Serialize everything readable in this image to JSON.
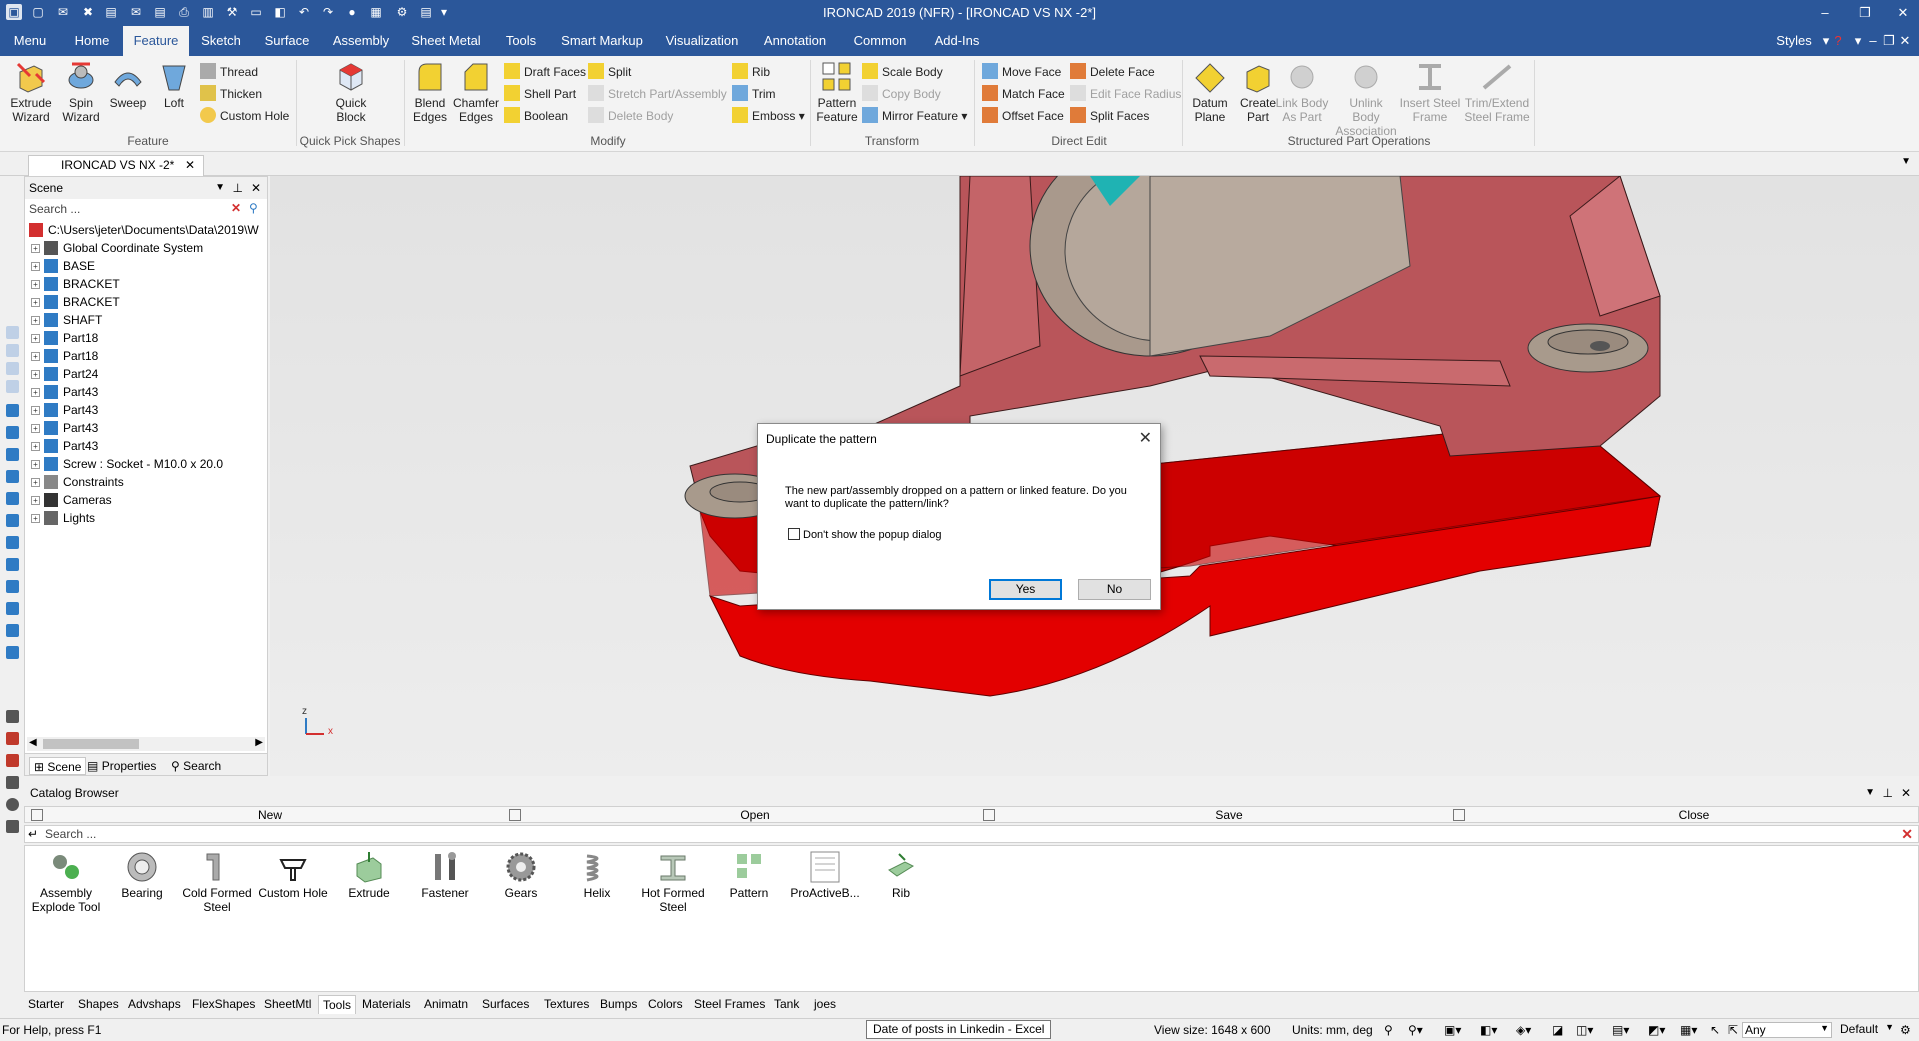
{
  "window": {
    "title": "IRONCAD 2019 (NFR) - [IRONCAD VS NX -2*]",
    "styles_label": "Styles",
    "help_glyph": "?",
    "minimize_glyph": "–",
    "restore_glyph": "❐",
    "close_glyph": "✕"
  },
  "menu_tabs": [
    "Menu",
    "Home",
    "Feature",
    "Sketch",
    "Surface",
    "Assembly",
    "Sheet Metal",
    "Tools",
    "Smart Markup",
    "Visualization",
    "Annotation",
    "Common",
    "Add-Ins"
  ],
  "ribbon": {
    "feature_group": {
      "label": "Feature",
      "extrude": "Extrude Wizard",
      "spin": "Spin Wizard",
      "sweep": "Sweep",
      "loft": "Loft",
      "thread": "Thread",
      "thicken": "Thicken",
      "custom_hole": "Custom Hole"
    },
    "quick_pick": {
      "label": "Quick Pick Shapes",
      "quick_block": "Quick Block"
    },
    "modify_group": {
      "label": "Modify",
      "blend_edges": "Blend Edges",
      "chamfer_edges": "Chamfer Edges",
      "draft_faces": "Draft Faces",
      "shell_part": "Shell Part",
      "boolean": "Boolean",
      "split": "Split",
      "stretch_part": "Stretch Part/Assembly",
      "delete_body": "Delete Body",
      "rib": "Rib",
      "trim": "Trim",
      "emboss": "Emboss"
    },
    "transform_group": {
      "label": "Transform",
      "pattern_feature": "Pattern Feature",
      "scale_body": "Scale Body",
      "copy_body": "Copy Body",
      "mirror_feature": "Mirror Feature"
    },
    "direct_edit_group": {
      "label": "Direct Edit",
      "move_face": "Move Face",
      "match_face": "Match Face",
      "offset_face": "Offset Face",
      "delete_face": "Delete Face",
      "edit_face_radius": "Edit Face Radius",
      "split_faces": "Split Faces"
    },
    "structured_group": {
      "label": "Structured Part Operations",
      "datum_plane": "Datum Plane",
      "create_part": "Create Part",
      "link_body": "Link Body As Part",
      "unlink_body": "Unlink Body Association",
      "insert_steel": "Insert Steel Frame",
      "trim_extend": "Trim/Extend Steel Frame"
    }
  },
  "document_tab": "IRONCAD VS NX -2*",
  "scene": {
    "title": "Scene",
    "search_placeholder": "Search ...",
    "root_path": "C:\\Users\\jeter\\Documents\\Data\\2019\\W",
    "items": [
      "Global Coordinate System",
      "BASE",
      "BRACKET",
      "BRACKET",
      "SHAFT",
      "Part18",
      "Part18",
      "Part24",
      "Part43",
      "Part43",
      "Part43",
      "Part43",
      "Screw : Socket - M10.0 x 20.0",
      "Constraints",
      "Cameras",
      "Lights"
    ],
    "bottom_tabs": [
      "Scene",
      "Properties",
      "Search"
    ]
  },
  "viewport": {
    "axis_labels": {
      "z": "z",
      "x": "x"
    },
    "colors": {
      "base_red": "#d40000",
      "bracket_red": "#b9555a",
      "shaft_tan": "#b5a79b",
      "teal": "#1fb3b3"
    }
  },
  "dialog": {
    "title": "Duplicate the pattern",
    "message": "The new part/assembly dropped on a pattern or linked feature. Do you want to duplicate the pattern/link?",
    "checkbox_label": "Don't show the popup dialog",
    "yes_label": "Yes",
    "no_label": "No"
  },
  "catalog": {
    "title": "Catalog Browser",
    "toolbar": [
      "New",
      "Open",
      "Save",
      "Close"
    ],
    "search_placeholder": "Search ...",
    "items": [
      {
        "label": "Assembly Explode Tool",
        "icon": "explode-icon"
      },
      {
        "label": "Bearing",
        "icon": "bearing-icon"
      },
      {
        "label": "Cold Formed Steel",
        "icon": "cold-formed-steel-icon"
      },
      {
        "label": "Custom Hole",
        "icon": "custom-hole-icon"
      },
      {
        "label": "Extrude",
        "icon": "extrude-icon"
      },
      {
        "label": "Fastener",
        "icon": "fastener-icon"
      },
      {
        "label": "Gears",
        "icon": "gear-icon"
      },
      {
        "label": "Helix",
        "icon": "helix-icon"
      },
      {
        "label": "Hot Formed Steel",
        "icon": "hot-formed-steel-icon"
      },
      {
        "label": "Pattern",
        "icon": "pattern-icon"
      },
      {
        "label": "ProActiveB...",
        "icon": "proactive-icon"
      },
      {
        "label": "Rib",
        "icon": "rib-icon"
      }
    ],
    "tabs": [
      "Starter",
      "Shapes",
      "Advshaps",
      "FlexShapes",
      "SheetMtl",
      "Tools",
      "Materials",
      "Animatn",
      "Surfaces",
      "Textures",
      "Bumps",
      "Colors",
      "Steel Frames",
      "Tank",
      "joes"
    ],
    "active_tab": "Tools"
  },
  "status": {
    "help": "For Help, press F1",
    "tooltip": "Date of posts in Linkedin - Excel",
    "view_size": "View size: 1648 x 600",
    "units": "Units: mm, deg",
    "filter": "Any",
    "style": "Default"
  }
}
